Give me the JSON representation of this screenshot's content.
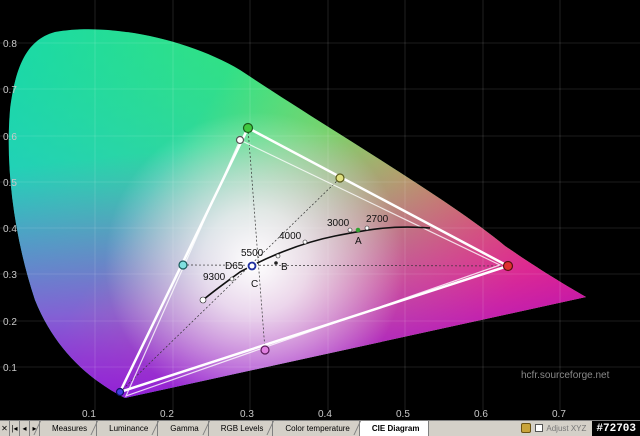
{
  "axes": {
    "x_ticks": [
      "0.1",
      "0.2",
      "0.3",
      "0.4",
      "0.5",
      "0.6",
      "0.7"
    ],
    "y_ticks": [
      "0.8",
      "0.7",
      "0.6",
      "0.5",
      "0.4",
      "0.3",
      "0.2",
      "0.1"
    ]
  },
  "annotations": {
    "k9300": "9300",
    "k5500": "5500",
    "k4000": "4000",
    "k3000": "3000",
    "k2700": "2700",
    "d65": "D65",
    "a": "A",
    "b": "B",
    "c": "C"
  },
  "watermark": "hcfr.sourceforge.net",
  "tabs": [
    {
      "label": "Measures"
    },
    {
      "label": "Luminance"
    },
    {
      "label": "Gamma"
    },
    {
      "label": "RGB Levels"
    },
    {
      "label": "Color temperature"
    },
    {
      "label": "CIE Diagram",
      "active": true
    }
  ],
  "nav": {
    "close": "✕",
    "first": "|◂",
    "prev": "◂",
    "next": "▸"
  },
  "status": {
    "adjust_label": "Adjust XYZ",
    "tag": "#72703"
  },
  "colors": {
    "background": "#000000",
    "gamut_reference": "#ffffff",
    "gamut_measured": "#ffffff"
  }
}
